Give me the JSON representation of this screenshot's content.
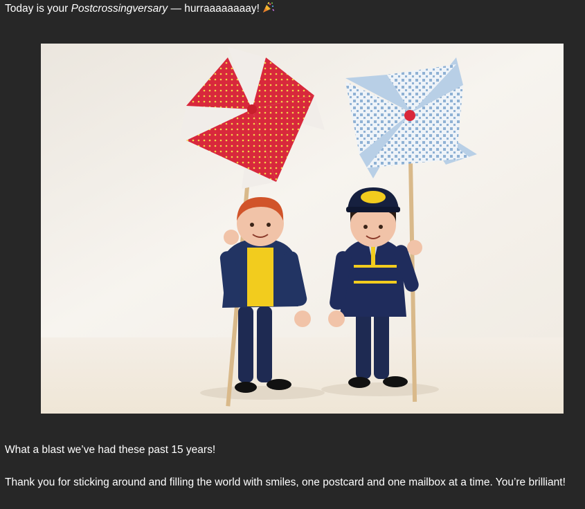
{
  "message": {
    "headline_prefix": "Today is your ",
    "headline_emphasis": "Postcrossingversary",
    "headline_suffix": " — hurraaaaaaaay!",
    "headline_icon": "party-popper-icon",
    "paragraphs": [
      "What a blast we’ve had these past 15 years!",
      "Thank you for sticking around and filling the world with smiles, one postcard and one mailbox at a time. You’re brilliant!"
    ]
  },
  "photo": {
    "subject": "two toy figures holding paper pinwheels"
  },
  "colors": {
    "background": "#272727",
    "text": "#ffffff",
    "photo_backdrop": "#f4f0ea",
    "pinwheel_red": "#d8283c",
    "pinwheel_blue": "#a9c4de",
    "uniform_navy": "#1e2a52",
    "accent_yellow": "#f2cc1e"
  }
}
